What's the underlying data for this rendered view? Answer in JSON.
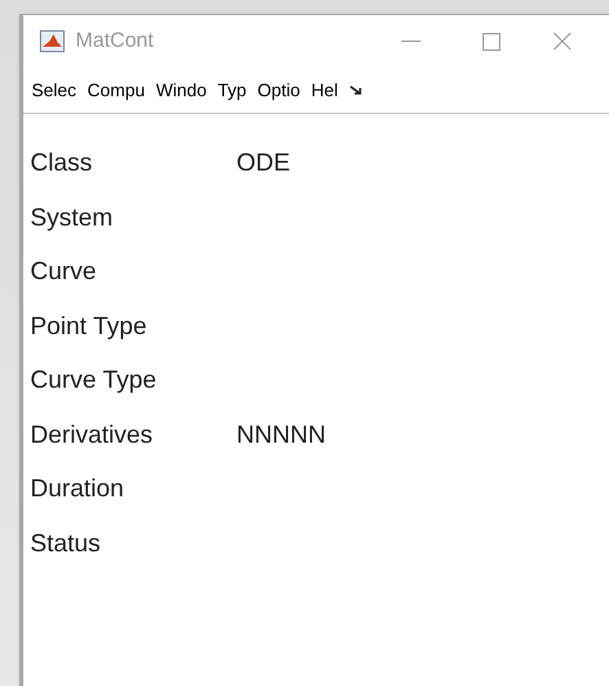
{
  "window": {
    "title": "MatCont"
  },
  "menu": [
    "Selec",
    "Compu",
    "Windo",
    "Typ",
    "Optio",
    "Hel"
  ],
  "fields": [
    {
      "label": "Class",
      "value": "ODE"
    },
    {
      "label": "System"
    },
    {
      "label": "Curve"
    },
    {
      "label": "Point Type"
    },
    {
      "label": "Curve Type"
    },
    {
      "label": "Derivatives",
      "value": "NNNNN"
    },
    {
      "label": "Duration"
    },
    {
      "label": "Status"
    }
  ]
}
